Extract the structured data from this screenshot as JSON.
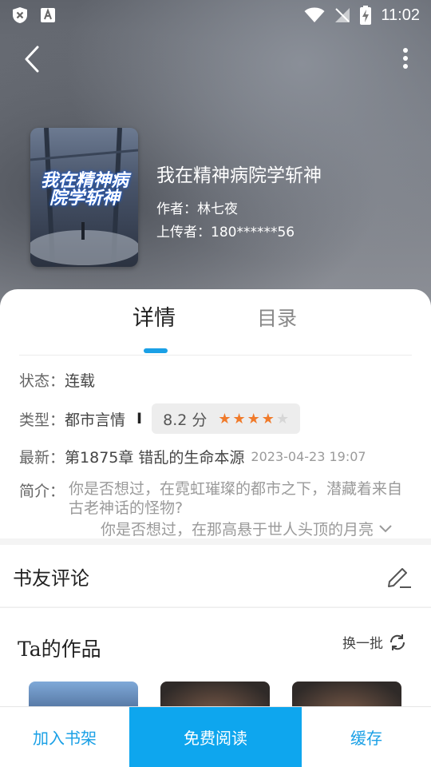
{
  "status_bar": {
    "time": "11:02"
  },
  "book": {
    "title": "我在精神病院学斩神",
    "author_line": "作者：林七夜",
    "uploader_line": "上传者：180******56",
    "cover_text": "我在精神病院学斩神"
  },
  "tabs": {
    "detail": "详情",
    "catalog": "目录"
  },
  "details": {
    "status_label": "状态：",
    "status_value": "连载",
    "type_label": "类型：",
    "type_value": "都市言情",
    "separator": "I",
    "rating_text": "8.2 分",
    "rating_value": 4.1,
    "latest_label": "最新：",
    "latest_chapter": "第1875章 错乱的生命本源",
    "latest_date": "2023-04-23 19:07",
    "intro_label": "简介：",
    "intro_text": "你是否想过，在霓虹璀璨的都市之下，潜藏着来自古老神话的怪物?",
    "intro_more": "你是否想过，在那高悬于世人头顶的月亮"
  },
  "comments": {
    "title": "书友评论"
  },
  "works": {
    "title": "Ta的作品",
    "refresh_label": "换一批"
  },
  "bottom_bar": {
    "shelf": "加入书架",
    "read": "免费阅读",
    "cache": "缓存"
  },
  "colors": {
    "accent": "#0ea6ee",
    "star": "#f07a2a"
  }
}
